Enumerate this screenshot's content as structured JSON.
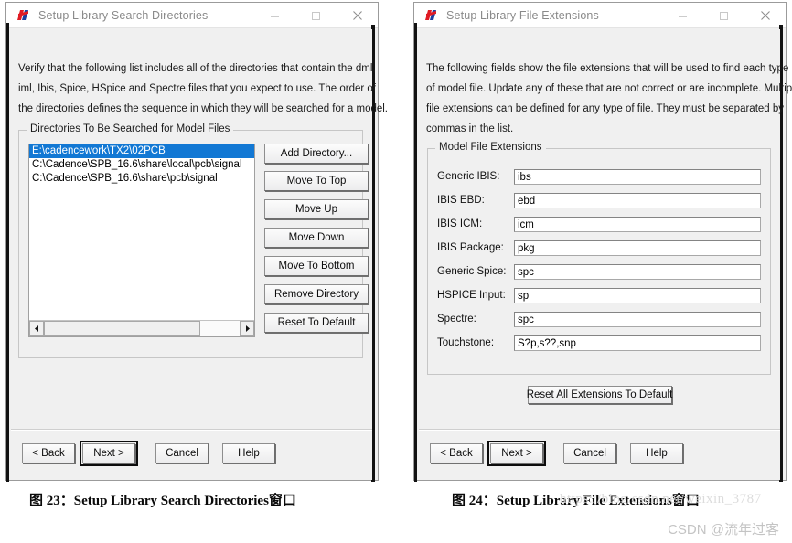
{
  "dialog_left": {
    "title": "Setup Library Search Directories",
    "icon": "cadence-app-icon",
    "window_controls": {
      "minimize": "minimize-icon",
      "maximize": "maximize-icon",
      "close": "close-icon"
    },
    "intro_lines": [
      "Verify that the following list includes all of the directories that contain the dml,",
      "iml, Ibis, Spice, HSpice and Spectre files that you expect to use.  The order of",
      "the directories defines the sequence in which they will be searched for a model."
    ],
    "group_title": "Directories To Be Searched for Model Files",
    "directories": [
      {
        "path": "E:\\cadencework\\TX2\\02PCB",
        "selected": true
      },
      {
        "path": "C:\\Cadence\\SPB_16.6\\share\\local\\pcb\\signal",
        "selected": false
      },
      {
        "path": "C:\\Cadence\\SPB_16.6\\share\\pcb\\signal",
        "selected": false
      }
    ],
    "side_buttons": [
      "Add Directory...",
      "Move To Top",
      "Move Up",
      "Move Down",
      "Move To Bottom",
      "Remove Directory",
      "Reset To Default"
    ],
    "footer_buttons": [
      {
        "label": "< Back",
        "focused": false
      },
      {
        "label": "Next >",
        "focused": true
      },
      {
        "label": "Cancel",
        "focused": false
      },
      {
        "label": "Help",
        "focused": false
      }
    ]
  },
  "dialog_right": {
    "title": "Setup Library File Extensions",
    "icon": "cadence-app-icon",
    "window_controls": {
      "minimize": "minimize-icon",
      "maximize": "maximize-icon",
      "close": "close-icon"
    },
    "intro_lines": [
      "The following fields show the file extensions that will be used to find each type",
      "of model file. Update any of these that are not correct or are incomplete. Multiple",
      "file extensions can be defined for any type of file. They must be separated by",
      "commas in the list."
    ],
    "group_title": "Model File Extensions",
    "fields": [
      {
        "label": "Generic IBIS:",
        "value": "ibs"
      },
      {
        "label": "IBIS EBD:",
        "value": "ebd"
      },
      {
        "label": "IBIS ICM:",
        "value": "icm"
      },
      {
        "label": "IBIS Package:",
        "value": "pkg"
      },
      {
        "label": "Generic Spice:",
        "value": "spc"
      },
      {
        "label": "HSPICE Input:",
        "value": "sp"
      },
      {
        "label": "Spectre:",
        "value": "spc"
      },
      {
        "label": "Touchstone:",
        "value": "S?p,s??,snp"
      }
    ],
    "reset_all_button": "Reset All Extensions To Default",
    "footer_buttons": [
      {
        "label": "< Back",
        "focused": false
      },
      {
        "label": "Next >",
        "focused": true
      },
      {
        "label": "Cancel",
        "focused": false
      },
      {
        "label": "Help",
        "focused": false
      }
    ]
  },
  "captions": {
    "left": "图 23：Setup Library Search Directories窗口",
    "right": "图 24：Setup Library File Extensions窗口"
  },
  "watermarks": {
    "url": "https://blog.csdn.net/weixin_3787",
    "csdn": "CSDN @流年过客"
  },
  "colors": {
    "selection_blue": "#1278d4",
    "dialog_bg": "#f0f0f0",
    "title_text": "#8a8a8a",
    "icon_red": "#e01b24",
    "icon_blue": "#1a3fa0"
  }
}
